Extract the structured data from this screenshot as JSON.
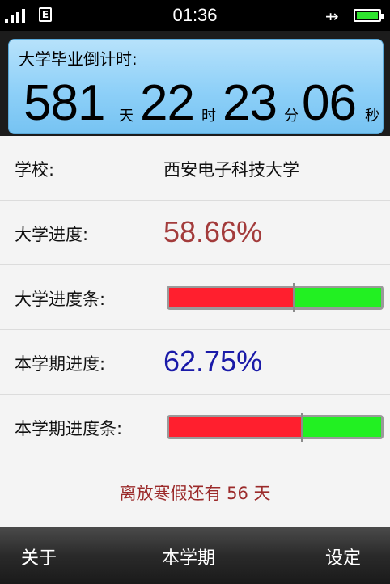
{
  "status": {
    "time": "01:36",
    "network": "E"
  },
  "countdown": {
    "title": "大学毕业倒计时:",
    "days": "581",
    "days_unit": "天",
    "hours": "22",
    "hours_unit": "时",
    "minutes": "23",
    "minutes_unit": "分",
    "seconds": "06",
    "seconds_unit": "秒"
  },
  "school": {
    "label": "学校:",
    "value": "西安电子科技大学"
  },
  "university_progress": {
    "label": "大学进度:",
    "value": "58.66%",
    "fraction": 0.5866,
    "color": "#a33b3b"
  },
  "university_bar": {
    "label": "大学进度条:"
  },
  "semester_progress": {
    "label": "本学期进度:",
    "value": "62.75%",
    "fraction": 0.6275,
    "color": "#1a1aa8"
  },
  "semester_bar": {
    "label": "本学期进度条:"
  },
  "note": "离放寒假还有 56 天",
  "nav": {
    "about": "关于",
    "semester": "本学期",
    "settings": "设定"
  }
}
